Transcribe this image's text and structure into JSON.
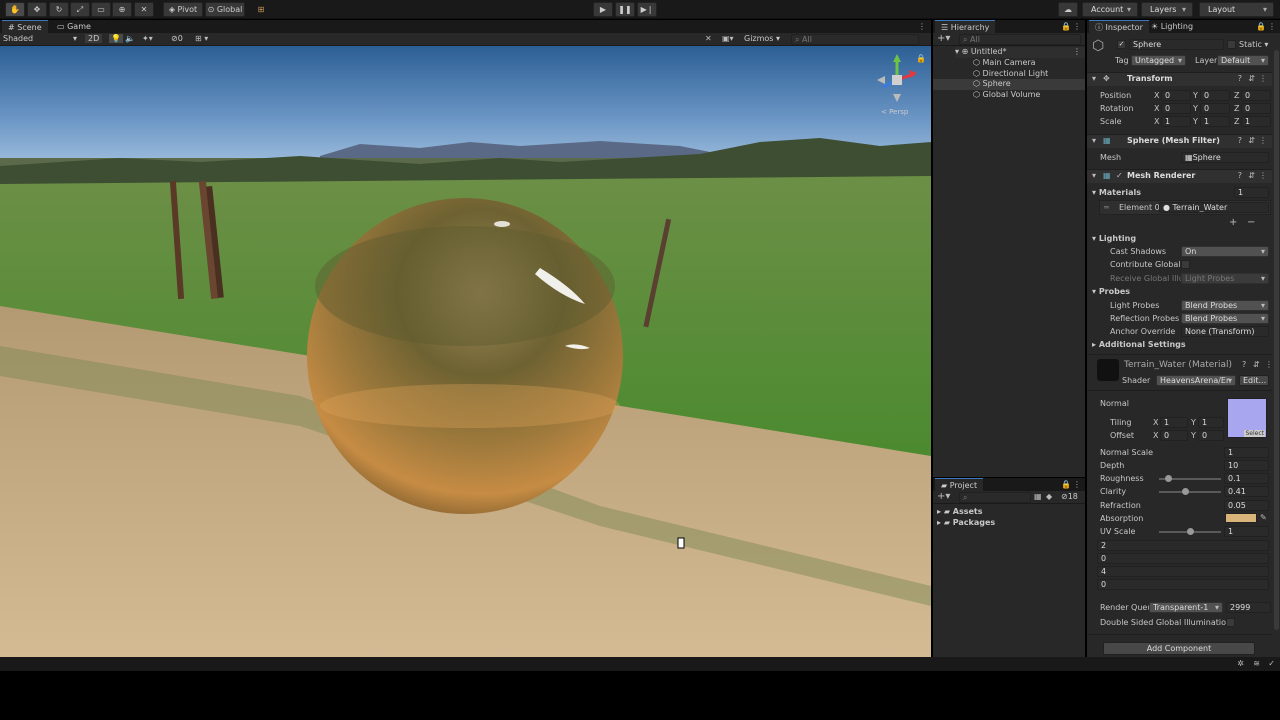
{
  "toolbar": {
    "pivot": "Pivot",
    "global": "Global",
    "account": "Account",
    "layers": "Layers",
    "layout": "Layout"
  },
  "scene_panel": {
    "tabs": [
      "Scene",
      "Game"
    ],
    "shading": "Shaded",
    "mode_2d": "2D",
    "hidden_count": "0",
    "gizmos": "Gizmos",
    "search_placeholder": "All",
    "persp_label": "< Persp"
  },
  "hierarchy": {
    "tab": "Hierarchy",
    "search_placeholder": "All",
    "scene_name": "Untitled*",
    "items": [
      "Main Camera",
      "Directional Light",
      "Sphere",
      "Global Volume"
    ]
  },
  "project": {
    "tab": "Project",
    "count": "18",
    "folders": [
      "Assets",
      "Packages"
    ]
  },
  "inspector": {
    "tabs": [
      "Inspector",
      "Lighting"
    ],
    "object_name": "Sphere",
    "static_label": "Static",
    "tag_label": "Tag",
    "tag_value": "Untagged",
    "layer_label": "Layer",
    "layer_value": "Default",
    "transform": {
      "title": "Transform",
      "rows": [
        {
          "label": "Position",
          "x": "0",
          "y": "0",
          "z": "0"
        },
        {
          "label": "Rotation",
          "x": "0",
          "y": "0",
          "z": "0"
        },
        {
          "label": "Scale",
          "x": "1",
          "y": "1",
          "z": "1"
        }
      ]
    },
    "mesh_filter": {
      "title": "Sphere (Mesh Filter)",
      "mesh_label": "Mesh",
      "mesh_value": "Sphere"
    },
    "mesh_renderer": {
      "title": "Mesh Renderer",
      "materials_label": "Materials",
      "materials_count": "1",
      "element_label": "Element 0",
      "element_value": "Terrain_Water",
      "lighting_label": "Lighting",
      "cast_shadows_label": "Cast Shadows",
      "cast_shadows_value": "On",
      "contribute_gi_label": "Contribute Global I",
      "receive_gi_label": "Receive Global Illu",
      "receive_gi_value": "Light Probes",
      "probes_label": "Probes",
      "light_probes_label": "Light Probes",
      "light_probes_value": "Blend Probes",
      "reflection_probes_label": "Reflection Probes",
      "reflection_probes_value": "Blend Probes",
      "anchor_override_label": "Anchor Override",
      "anchor_override_value": "None (Transform)",
      "additional_settings": "Additional Settings"
    },
    "material": {
      "title": "Terrain_Water (Material)",
      "shader_label": "Shader",
      "shader_value": "HeavensArena/En",
      "edit_label": "Edit...",
      "normal_label": "Normal",
      "tiling_label": "Tiling",
      "tiling_x": "1",
      "tiling_y": "1",
      "offset_label": "Offset",
      "offset_x": "0",
      "offset_y": "0",
      "select_label": "Select",
      "props": [
        {
          "label": "Normal Scale",
          "value": "1"
        },
        {
          "label": "Depth",
          "value": "10"
        },
        {
          "label": "Roughness",
          "value": "0.1",
          "slider": 0.1
        },
        {
          "label": "Clarity",
          "value": "0.41",
          "slider": 0.41
        },
        {
          "label": "Refraction",
          "value": "0.05"
        },
        {
          "label": "Absorption",
          "value": ""
        },
        {
          "label": "UV Scale",
          "value": "1",
          "slider": 0.5
        }
      ],
      "vector_values": [
        "2",
        "0",
        "4",
        "0"
      ],
      "render_queue_label": "Render Queu",
      "render_queue_value": "Transparent-1",
      "render_queue_number": "2999",
      "double_sided_gi": "Double Sided Global Illumination",
      "absorption_color": "#d8b47a"
    },
    "add_component": "Add Component"
  },
  "colors": {
    "accent": "#3a79bb",
    "panel": "#282828",
    "toolbar": "#191919"
  }
}
